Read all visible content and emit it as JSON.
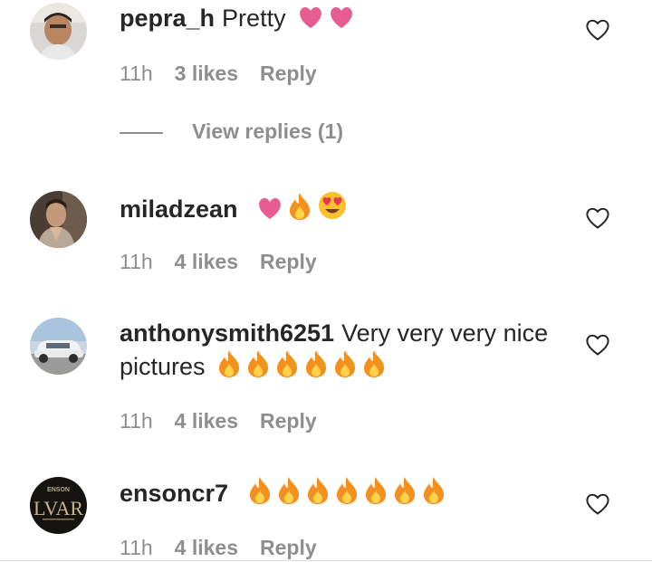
{
  "comments": [
    {
      "username": "pepra_h",
      "message": "Pretty",
      "emojis": [
        "heart",
        "heart"
      ],
      "time": "11h",
      "likes": "3 likes",
      "reply": "Reply",
      "view_replies": "View replies (1)"
    },
    {
      "username": "miladzean",
      "message": "",
      "emojis": [
        "heart",
        "fire",
        "heart-eyes"
      ],
      "time": "11h",
      "likes": "4 likes",
      "reply": "Reply"
    },
    {
      "username": "anthonysmith6251",
      "message": "Very very very nice pictures",
      "emojis": [
        "fire",
        "fire",
        "fire",
        "fire",
        "fire",
        "fire"
      ],
      "time": "11h",
      "likes": "4 likes",
      "reply": "Reply"
    },
    {
      "username": "ensoncr7",
      "message": "",
      "emojis": [
        "fire",
        "fire",
        "fire",
        "fire",
        "fire",
        "fire",
        "fire"
      ],
      "time": "11h",
      "likes": "4 likes",
      "reply": "Reply"
    }
  ],
  "avatar_texts": {
    "ensoncr7_line1": "ENSON",
    "ensoncr7_line2": "LVAR"
  },
  "colors": {
    "text": "#262626",
    "meta": "#8e8e8e",
    "heart_emoji": "#e75c91",
    "fire_outer": "#f4901e",
    "fire_inner": "#fcd34d"
  }
}
